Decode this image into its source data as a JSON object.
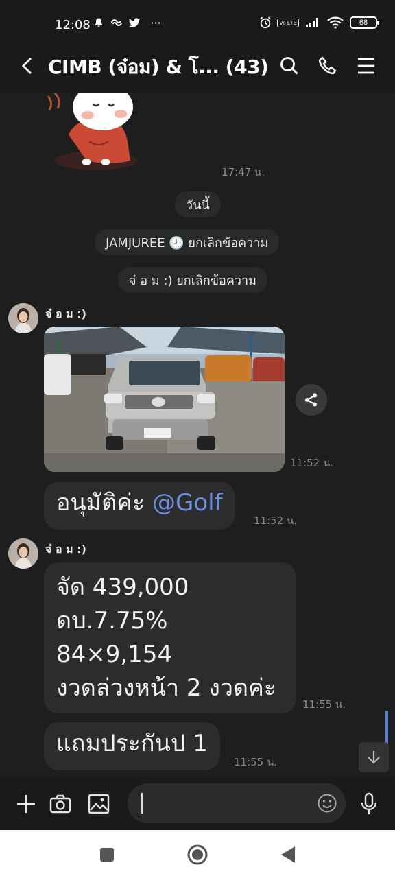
{
  "status_bar": {
    "time": "12:08",
    "battery": "68",
    "volte": "Vo LTE",
    "more": "···"
  },
  "header": {
    "title": "CIMB (จ๋อม) & โ... (43)"
  },
  "chat": {
    "sticker_time": "17:47 น.",
    "date_separator": "วันนี้",
    "system_messages": [
      "JAMJUREE 🕗 ยกเลิกข้อความ",
      "จ๋ อ ม :) ยกเลิกข้อความ"
    ],
    "groups": [
      {
        "sender": "จ๋ อ ม :)",
        "photo_time": "11:52 น.",
        "message_text": "อนุมัติค่ะ ",
        "mention": "@Golf",
        "message_time": "11:52 น."
      },
      {
        "sender": "จ๋ อ ม :)",
        "message_1": "จัด 439,000\nดบ.7.75%\n84×9,154\nงวดล่วงหน้า 2 งวดค่ะ",
        "message_1_time": "11:55 น.",
        "message_2": "แถมประกันป 1",
        "message_2_time": "11:55 น."
      }
    ]
  },
  "input": {
    "placeholder": ""
  },
  "colors": {
    "background": "#1e1e1e",
    "bubble": "#2c2c2c",
    "mention": "#6b8ee6",
    "scroll_indicator": "#5a7fd6"
  },
  "icons": [
    "bell-icon",
    "twitter-icon",
    "alarm-icon",
    "signal-icon",
    "wifi-icon",
    "back-icon",
    "search-icon",
    "phone-icon",
    "menu-icon",
    "share-icon",
    "scroll-down-icon",
    "plus-icon",
    "camera-icon",
    "image-icon",
    "emoji-icon",
    "mic-icon",
    "recent-apps-icon",
    "home-icon",
    "back-nav-icon"
  ]
}
